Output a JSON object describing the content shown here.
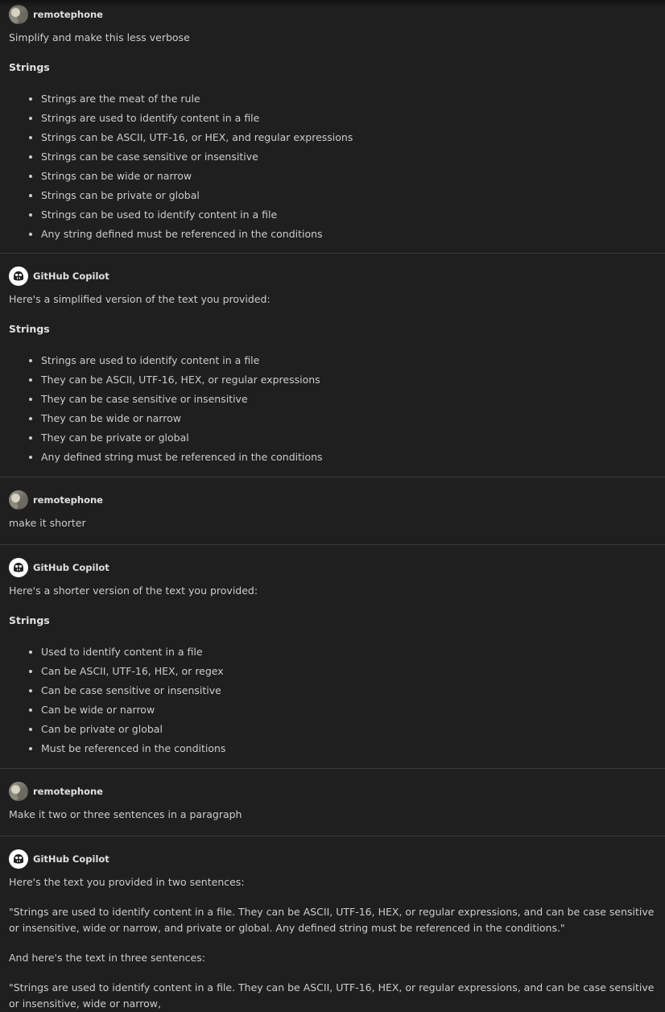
{
  "messages": [
    {
      "author": "remotephone",
      "text": "Simplify and make this less verbose",
      "heading": "Strings",
      "items": [
        "Strings are the meat of the rule",
        "Strings are used to identify content in a file",
        "Strings can be ASCII, UTF-16, or HEX, and regular expressions",
        "Strings can be case sensitive or insensitive",
        "Strings can be wide or narrow",
        "Strings can be private or global",
        "Strings can be used to identify content in a file",
        "Any string defined must be referenced in the conditions"
      ]
    },
    {
      "author": "GitHub Copilot",
      "text": "Here's a simplified version of the text you provided:",
      "heading": "Strings",
      "items": [
        "Strings are used to identify content in a file",
        "They can be ASCII, UTF-16, HEX, or regular expressions",
        "They can be case sensitive or insensitive",
        "They can be wide or narrow",
        "They can be private or global",
        "Any defined string must be referenced in the conditions"
      ]
    },
    {
      "author": "remotephone",
      "text": "make it shorter"
    },
    {
      "author": "GitHub Copilot",
      "text": "Here's a shorter version of the text you provided:",
      "heading": "Strings",
      "items": [
        "Used to identify content in a file",
        "Can be ASCII, UTF-16, HEX, or regex",
        "Can be case sensitive or insensitive",
        "Can be wide or narrow",
        "Can be private or global",
        "Must be referenced in the conditions"
      ]
    },
    {
      "author": "remotephone",
      "text": "Make it two or three sentences in a paragraph"
    },
    {
      "author": "GitHub Copilot",
      "text": "Here's the text you provided in two sentences:",
      "paragraph": "\"Strings are used to identify content in a file. They can be ASCII, UTF-16, HEX, or regular expressions, and can be case sensitive or insensitive, wide or narrow, and private or global. Any defined string must be referenced in the conditions.\"",
      "text2": "And here's the text in three sentences:",
      "partial": "\"Strings are used to identify content in a file. They can be ASCII, UTF-16, HEX, or regular expressions, and can be case sensitive or insensitive, wide or narrow,"
    }
  ]
}
